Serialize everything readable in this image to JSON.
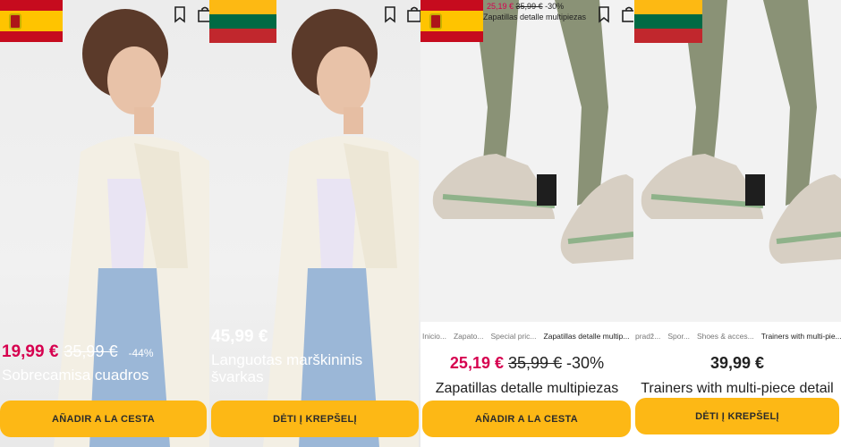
{
  "panels": [
    {
      "flag": "spain",
      "price": {
        "sale": "19,99 €",
        "old": "35,99 €",
        "discount": "-44%"
      },
      "title": "Sobrecamisa cuadros",
      "button": "AÑADIR A LA CESTA"
    },
    {
      "flag": "lithuania",
      "price": {
        "regular": "45,99 €"
      },
      "title_line1": "Languotas marškininis",
      "title_line2": "švarkas",
      "button": "DĖTI Į KREPŠELĮ"
    },
    {
      "flag": "spain",
      "mini_price": {
        "sale": "25,19 €",
        "old": "35,99 €",
        "discount": "-30%"
      },
      "mini_title": "Zapatillas detalle multipiezas",
      "breadcrumbs": [
        "Inicio...",
        "Zapato...",
        "Special pric...",
        "Zapatillas detalle multip..."
      ],
      "price": {
        "sale": "25,19 €",
        "old": "35,99 €",
        "discount": "-30%"
      },
      "title": "Zapatillas detalle multipiezas",
      "button": "AÑADIR A LA CESTA"
    },
    {
      "flag": "lithuania",
      "breadcrumbs": [
        "pradž...",
        "Spor...",
        "Shoes & acces...",
        "Trainers with multi-pie..."
      ],
      "price": {
        "regular": "39,99 €"
      },
      "title": "Trainers with multi-piece detail",
      "button": "DĖTI Į KREPŠELĮ"
    }
  ],
  "icons": [
    "bookmark-icon",
    "bag-icon"
  ],
  "colors": {
    "accent": "#fdb815",
    "sale": "#d6004f"
  }
}
